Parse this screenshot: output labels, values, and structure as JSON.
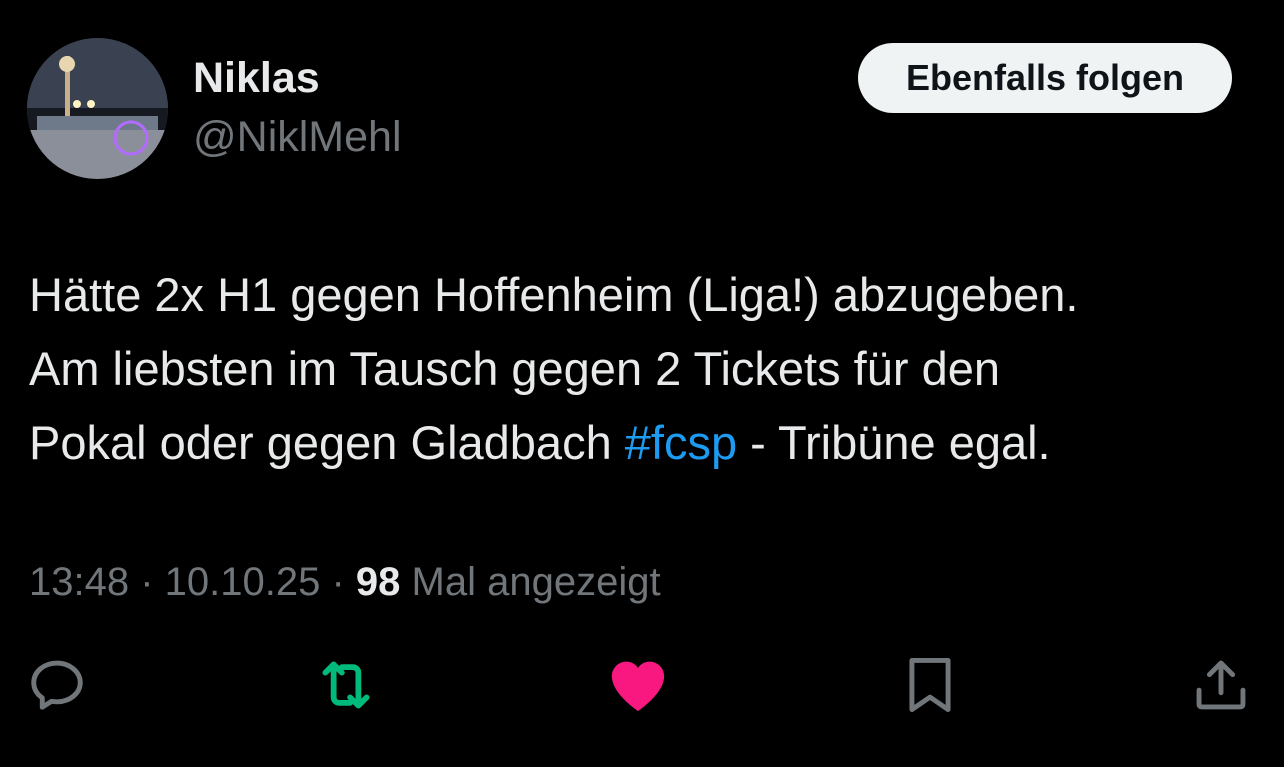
{
  "author": {
    "name": "Niklas",
    "handle": "@NiklMehl"
  },
  "follow_button": {
    "label": "Ebenfalls folgen"
  },
  "tweet": {
    "line1": "Hätte 2x H1 gegen Hoffenheim (Liga!) abzugeben.",
    "line2": "Am liebsten im Tausch gegen 2 Tickets für den",
    "line3_before": "Pokal oder gegen Gladbach ",
    "hashtag": "#fcsp",
    "line3_after": " - Tribüne egal."
  },
  "meta": {
    "time": "13:48",
    "separator1": " · ",
    "date": "10.10.25",
    "separator2": " · ",
    "views_count": "98",
    "views_label": " Mal angezeigt"
  },
  "actions": [
    {
      "icon": "reply-icon",
      "state": "default"
    },
    {
      "icon": "retweet-icon",
      "state": "active"
    },
    {
      "icon": "like-icon",
      "state": "active"
    },
    {
      "icon": "bookmark-icon",
      "state": "default"
    },
    {
      "icon": "share-icon",
      "state": "default"
    }
  ],
  "colors": {
    "background": "#000000",
    "text_primary": "#e7e9ea",
    "text_secondary": "#71767b",
    "hashtag": "#1d9bf0",
    "retweet_active": "#00ba7c",
    "like_active": "#f91880",
    "button_bg": "#eff3f4"
  }
}
